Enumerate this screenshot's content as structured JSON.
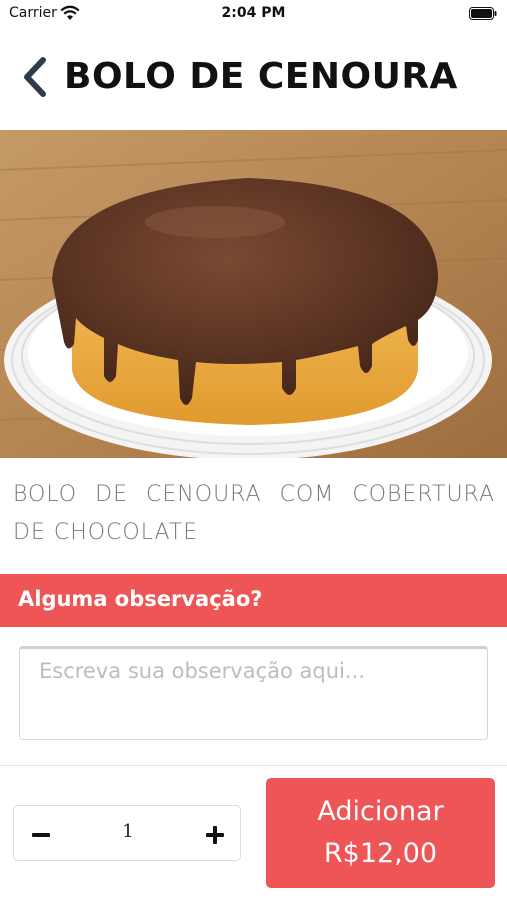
{
  "status_bar": {
    "carrier": "Carrier",
    "time": "2:04 PM"
  },
  "header": {
    "title": "BOLO DE CENOURA",
    "back_icon": "chevron-left-icon"
  },
  "product": {
    "image_alt": "carrot-cake-with-chocolate-topping",
    "description": "BOLO DE CENOURA COM COBERTURA DE CHOCOLATE"
  },
  "observation": {
    "section_title": "Alguma observação?",
    "value": "",
    "placeholder": "Escreva sua observação aqui..."
  },
  "quantity": {
    "value": "1",
    "minus_icon": "minus-icon",
    "plus_icon": "plus-icon"
  },
  "add_button": {
    "label": "Adicionar",
    "price": "R$12,00"
  },
  "colors": {
    "accent": "#ee5557",
    "text": "#111111",
    "muted": "#777777",
    "placeholder": "#b9bcc4"
  }
}
